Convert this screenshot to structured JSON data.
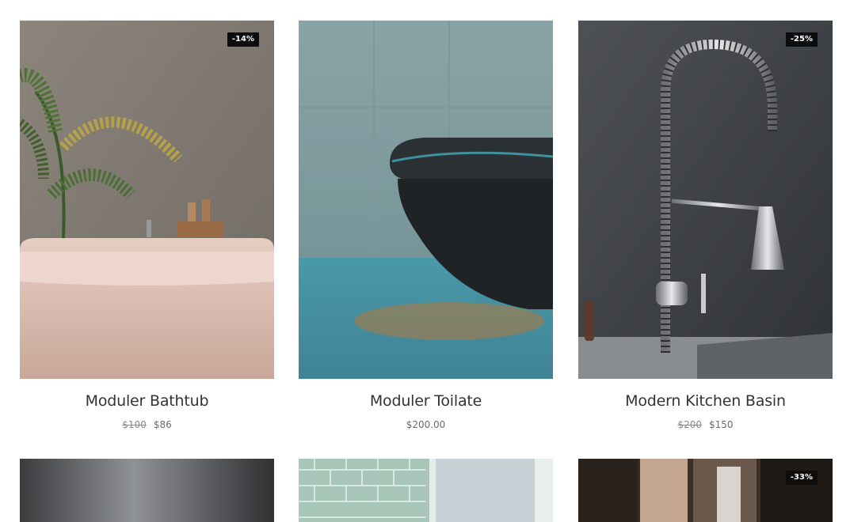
{
  "products": [
    {
      "name": "Moduler Bathtub",
      "old_price": "$100",
      "price": "$86",
      "badge": "-14%"
    },
    {
      "name": "Moduler Toilate",
      "old_price": "",
      "price": "$200.00",
      "badge": ""
    },
    {
      "name": "Modern Kitchen Basin",
      "old_price": "$200",
      "price": "$150",
      "badge": "-25%"
    }
  ],
  "row2": [
    {
      "badge": ""
    },
    {
      "badge": ""
    },
    {
      "badge": "-33%"
    }
  ],
  "colors": {
    "badge_bg": "#0d0d0d",
    "title": "#333333",
    "price": "#6b6b6b"
  }
}
